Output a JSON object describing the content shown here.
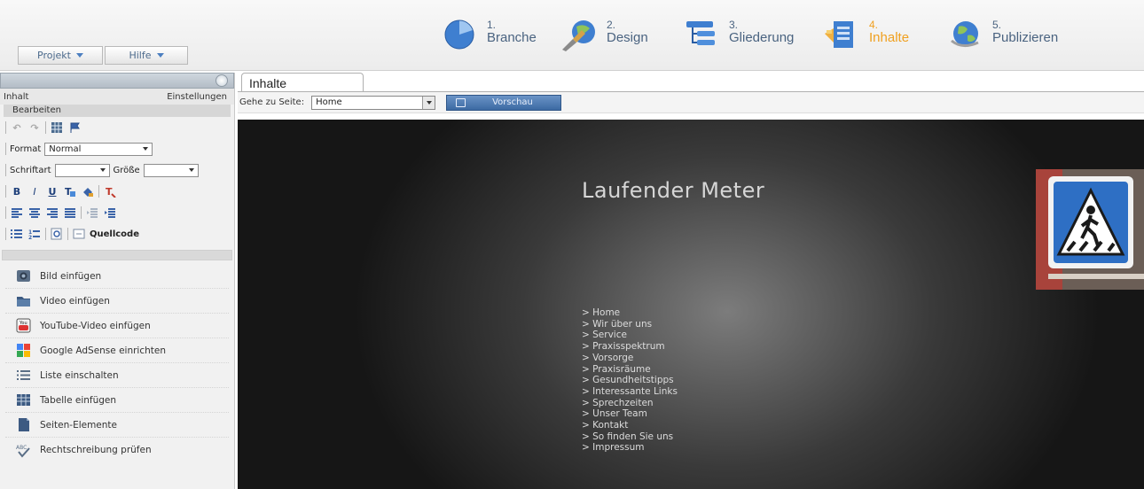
{
  "menu": {
    "projekt": "Projekt",
    "hilfe": "Hilfe"
  },
  "steps": [
    {
      "num": "1.",
      "label": "Branche",
      "icon": "pie-chart-icon"
    },
    {
      "num": "2.",
      "label": "Design",
      "icon": "brush-globe-icon"
    },
    {
      "num": "3.",
      "label": "Gliederung",
      "icon": "tree-structure-icon"
    },
    {
      "num": "4.",
      "label": "Inhalte",
      "icon": "content-pages-icon",
      "active": true
    },
    {
      "num": "5.",
      "label": "Publizieren",
      "icon": "globe-publish-icon"
    }
  ],
  "left_panel": {
    "tab_inhalt": "Inhalt",
    "tab_einstellungen": "Einstellungen",
    "subhead": "Bearbeiten",
    "format_label": "Format",
    "format_value": "Normal",
    "schriftart_label": "Schriftart",
    "schriftart_value": "",
    "groesse_label": "Größe",
    "groesse_value": "",
    "format_buttons": {
      "bold": "B",
      "italic": "I",
      "underline": "U"
    },
    "quellcode_label": "Quellcode",
    "actions": [
      {
        "label": "Bild einfügen",
        "icon": "image-icon"
      },
      {
        "label": "Video einfügen",
        "icon": "video-folder-icon"
      },
      {
        "label": "YouTube-Video einfügen",
        "icon": "youtube-icon"
      },
      {
        "label": "Google AdSense einrichten",
        "icon": "adsense-icon"
      },
      {
        "label": "Liste einschalten",
        "icon": "list-icon"
      },
      {
        "label": "Tabelle einfügen",
        "icon": "table-icon"
      },
      {
        "label": "Seiten-Elemente",
        "icon": "page-elements-icon"
      },
      {
        "label": "Rechtschreibung prüfen",
        "icon": "spellcheck-icon"
      }
    ]
  },
  "main": {
    "tab_label": "Inhalte",
    "goto_label": "Gehe zu Seite:",
    "goto_value": "Home",
    "preview_label": "Vorschau"
  },
  "site": {
    "title": "Laufender Meter",
    "nav": [
      "> Home",
      "> Wir über uns",
      "> Service",
      "> Praxisspektrum",
      "> Vorsorge",
      "> Praxisräume",
      "> Gesundheitstipps",
      "> Interessante Links",
      "> Sprechzeiten",
      "> Unser Team",
      "> Kontakt",
      "> So finden Sie uns",
      "> Impressum"
    ]
  },
  "colors": {
    "step_text": "#4a6380",
    "step_active": "#f0a020",
    "preview_button": "#3c6aa3"
  }
}
